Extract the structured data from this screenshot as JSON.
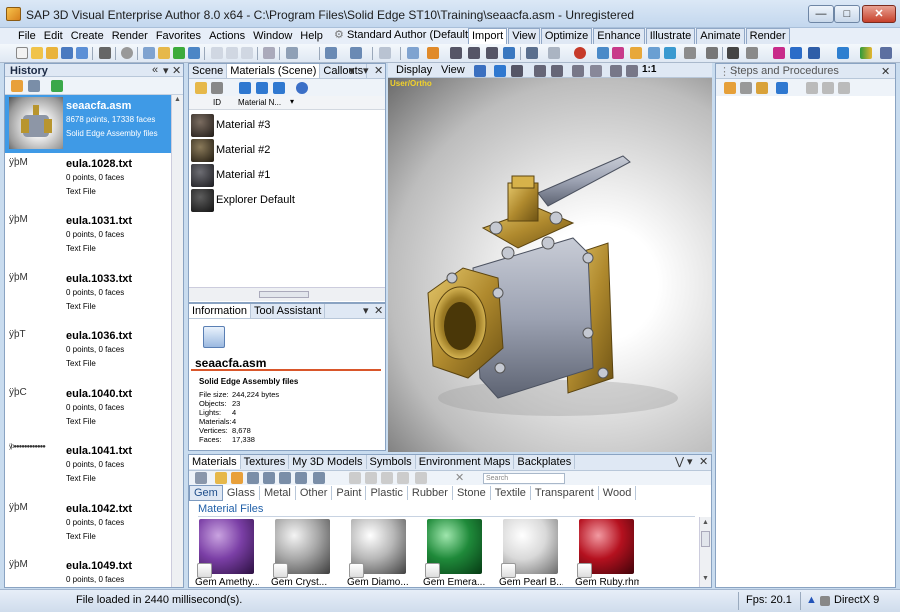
{
  "window": {
    "title": "SAP 3D Visual Enterprise Author 8.0 x64 - C:\\Program Files\\Solid Edge ST10\\Training\\seaacfa.asm - Unregistered",
    "minimize": "—",
    "maximize": "□",
    "close": "✕"
  },
  "menu": {
    "items": [
      "File",
      "Edit",
      "Create",
      "Render",
      "Favorites",
      "Actions",
      "Window",
      "Help"
    ],
    "author_mode": "Standard Author (Default)"
  },
  "ribbon": {
    "tabs": [
      "Import",
      "View",
      "Optimize",
      "Enhance",
      "Illustrate",
      "Animate",
      "Render"
    ],
    "active": "Import"
  },
  "history": {
    "title": "History",
    "items": [
      {
        "left": "",
        "name": "seaacfa.asm",
        "info": "8678 points, 17338 faces",
        "type": "Solid Edge Assembly files"
      },
      {
        "left": "ÿþM",
        "name": "eula.1028.txt",
        "info": "0 points, 0 faces",
        "type": "Text File"
      },
      {
        "left": "ÿþM",
        "name": "eula.1031.txt",
        "info": "0 points, 0 faces",
        "type": "Text File"
      },
      {
        "left": "ÿþM",
        "name": "eula.1033.txt",
        "info": "0 points, 0 faces",
        "type": "Text File"
      },
      {
        "left": "ÿþT",
        "name": "eula.1036.txt",
        "info": "0 points, 0 faces",
        "type": "Text File"
      },
      {
        "left": "ÿþC",
        "name": "eula.1040.txt",
        "info": "0 points, 0 faces",
        "type": "Text File"
      },
      {
        "left": "ÿþ●●●●●●●●●●●●",
        "name": "eula.1041.txt",
        "info": "0 points, 0 faces",
        "type": "Text File"
      },
      {
        "left": "ÿþM",
        "name": "eula.1042.txt",
        "info": "0 points, 0 faces",
        "type": "Text File"
      },
      {
        "left": "ÿþM",
        "name": "eula.1049.txt",
        "info": "0 points, 0 faces",
        "type": "Text File"
      }
    ]
  },
  "scene": {
    "tabs": [
      "Scene",
      "Materials (Scene)",
      "Callouts"
    ],
    "active": "Materials (Scene)",
    "col_id": "ID",
    "col_name": "Material N...",
    "materials": [
      "Material #3",
      "Material #2",
      "Material #1",
      "Explorer Default"
    ]
  },
  "info": {
    "tabs": [
      "Information",
      "Tool Assistant"
    ],
    "filename": "seaacfa.asm",
    "type": "Solid Edge Assembly files",
    "fields": [
      {
        "label": "File size:",
        "value": "244,224 bytes"
      },
      {
        "label": "Objects:",
        "value": "23"
      },
      {
        "label": "Lights:",
        "value": "4"
      },
      {
        "label": "Materials:",
        "value": "4"
      },
      {
        "label": "Vertices:",
        "value": "8,678"
      },
      {
        "label": "Faces:",
        "value": "17,338"
      }
    ]
  },
  "viewport": {
    "menu": [
      "Display",
      "View"
    ],
    "zoom_label": "1:1",
    "camera_label": "User/Ortho"
  },
  "steps": {
    "title": "Steps and Procedures"
  },
  "library": {
    "tabs": [
      "Materials",
      "Textures",
      "My 3D Models",
      "Symbols",
      "Environment Maps",
      "Backplates"
    ],
    "search_placeholder": "Search",
    "categories": [
      "Gem",
      "Glass",
      "Metal",
      "Other",
      "Paint",
      "Plastic",
      "Rubber",
      "Stone",
      "Textile",
      "Transparent",
      "Wood"
    ],
    "active_category": "Gem",
    "section": "Material Files",
    "items": [
      {
        "label": "Gem Amethy...",
        "color": "#7b3fa6"
      },
      {
        "label": "Gem Cryst...",
        "color": "#a8a8a8"
      },
      {
        "label": "Gem Diamo...",
        "color": "#b7b7b7"
      },
      {
        "label": "Gem Emera...",
        "color": "#1f8a3a"
      },
      {
        "label": "Gem Pearl B...",
        "color": "#d9d9d9"
      },
      {
        "label": "Gem Ruby.rhm",
        "color": "#b5111f"
      }
    ]
  },
  "status": {
    "text": "File loaded in 2440 millisecond(s).",
    "fps": "Fps: 20.1",
    "renderer": "DirectX 9"
  }
}
